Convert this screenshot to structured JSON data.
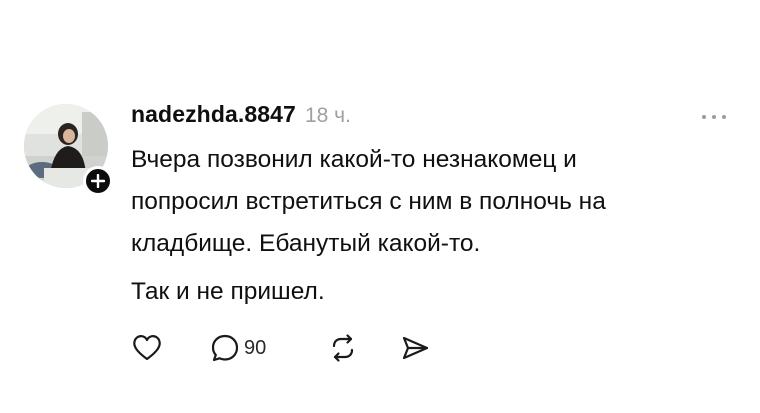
{
  "post": {
    "username": "nadezhda.8847",
    "timestamp": "18 ч.",
    "text_lines": [
      "Вчера позвонил какой-то незнакомец и",
      "попросил встретиться с ним в полночь на",
      "кладбище. Ебанутый какой-то.",
      "Так и не пришел."
    ],
    "reply_count": "90"
  },
  "icons": {
    "like": "heart-icon",
    "reply": "comment-icon",
    "repost": "repost-icon",
    "share": "send-icon",
    "more": "more-dots-icon",
    "follow": "plus-icon"
  },
  "colors": {
    "text": "#101010",
    "muted": "#a0a0a0",
    "badge": "#0c0c0c"
  }
}
